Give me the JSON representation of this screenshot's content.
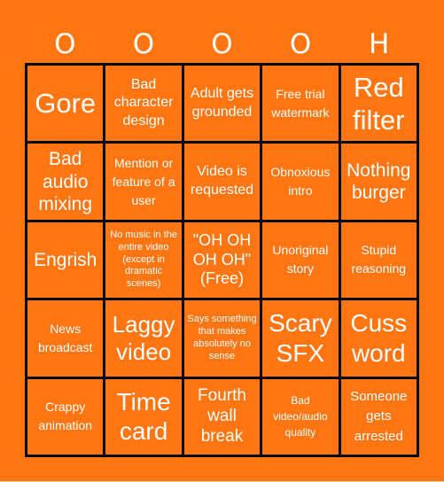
{
  "card": {
    "header": [
      "O",
      "O",
      "O",
      "O",
      "H"
    ],
    "colors": {
      "background": "#FF7512",
      "grid_lines": "#000000",
      "text": "#FFFFFF"
    },
    "cells": [
      [
        "Gore",
        "Bad character design",
        "Adult gets grounded",
        "Free trial watermark",
        "Red filter"
      ],
      [
        "Bad audio mixing",
        "Mention or feature of a user",
        "Video is requested",
        "Obnoxious intro",
        "Nothing burger"
      ],
      [
        "Engrish",
        "No music in the entire video (except in dramatic scenes)",
        "\"OH OH OH OH\" (Free)",
        "Unoriginal story",
        "Stupid reasoning"
      ],
      [
        "News broadcast",
        "Laggy video",
        "Says something that makes absolutely no sense",
        "Scary SFX",
        "Cuss word"
      ],
      [
        "Crappy animation",
        "Time card",
        "Fourth wall break",
        "Bad video/audio quality",
        "Someone gets arrested"
      ]
    ]
  }
}
